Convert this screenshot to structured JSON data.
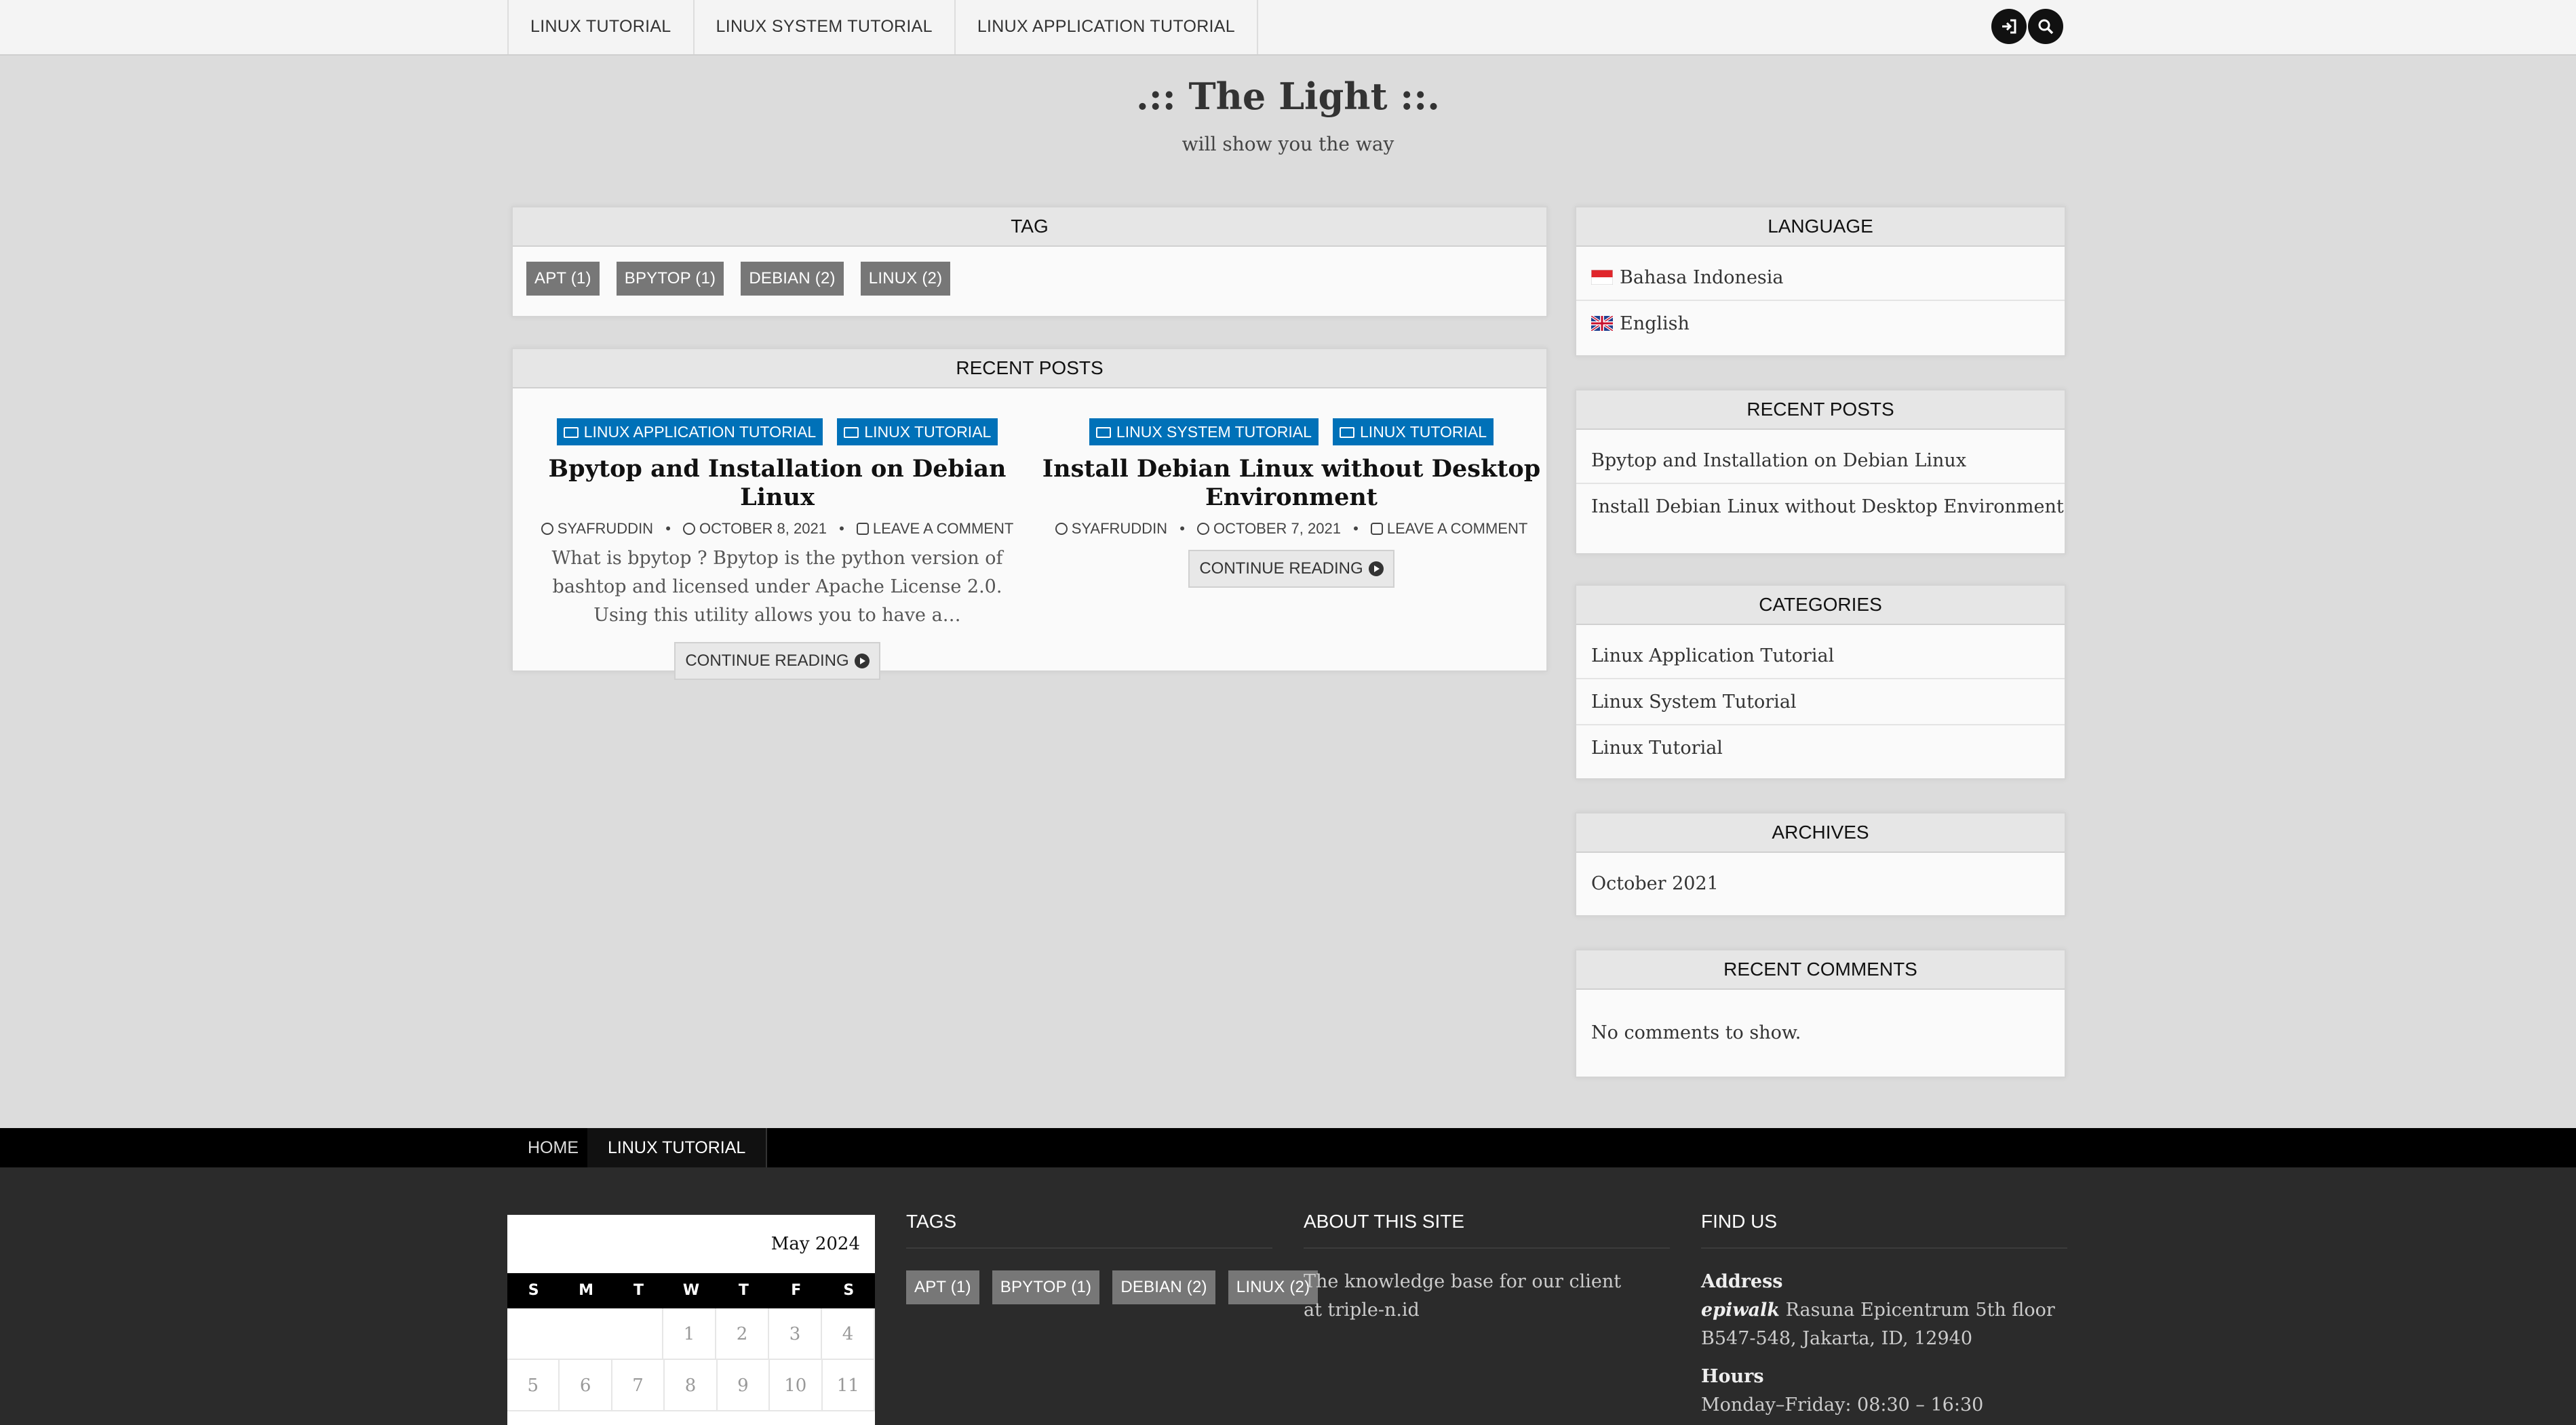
{
  "top_nav": {
    "items": [
      "LINUX TUTORIAL",
      "LINUX SYSTEM TUTORIAL",
      "LINUX APPLICATION TUTORIAL"
    ]
  },
  "header": {
    "title": ".:: The Light ::.",
    "tagline": "will show you the way"
  },
  "tag_widget": {
    "title": "TAG",
    "tags": [
      "APT (1)",
      "BPYTOP (1)",
      "DEBIAN (2)",
      "LINUX (2)"
    ]
  },
  "recent_posts_main": {
    "title": "RECENT POSTS",
    "posts": [
      {
        "categories": [
          "LINUX APPLICATION TUTORIAL",
          "LINUX TUTORIAL"
        ],
        "title": "Bpytop and Installation on Debian Linux",
        "author": "SYAFRUDDIN",
        "date": "OCTOBER 8, 2021",
        "comment": "LEAVE A COMMENT",
        "excerpt": "What is bpytop ? Bpytop is the python version of bashtop and licensed under Apache License 2.0. Using this utility allows you to have a…",
        "more": "CONTINUE READING"
      },
      {
        "categories": [
          "LINUX SYSTEM TUTORIAL",
          "LINUX TUTORIAL"
        ],
        "title": "Install Debian Linux without Desktop Environment",
        "author": "SYAFRUDDIN",
        "date": "OCTOBER 7, 2021",
        "comment": "LEAVE A COMMENT",
        "more": "CONTINUE READING"
      }
    ]
  },
  "sidebar": {
    "language": {
      "title": "LANGUAGE",
      "items": [
        "Bahasa Indonesia",
        "English"
      ]
    },
    "recent_posts": {
      "title": "RECENT POSTS",
      "items": [
        "Bpytop and Installation on Debian Linux",
        "Install Debian Linux without Desktop Environment"
      ]
    },
    "categories": {
      "title": "CATEGORIES",
      "items": [
        "Linux Application Tutorial",
        "Linux System Tutorial",
        "Linux Tutorial"
      ]
    },
    "archives": {
      "title": "ARCHIVES",
      "items": [
        "October 2021"
      ]
    },
    "recent_comments": {
      "title": "RECENT COMMENTS",
      "text": "No comments to show."
    }
  },
  "footer_nav": {
    "items": [
      "HOME",
      "LINUX TUTORIAL"
    ]
  },
  "footer": {
    "calendar": {
      "caption": "May 2024",
      "days": [
        "S",
        "M",
        "T",
        "W",
        "T",
        "F",
        "S"
      ],
      "week1": [
        "1",
        "2",
        "3",
        "4"
      ],
      "week2": [
        "5",
        "6",
        "7",
        "8",
        "9",
        "10",
        "11"
      ]
    },
    "tags": {
      "title": "TAGS",
      "items": [
        "APT (1)",
        "BPYTOP (1)",
        "DEBIAN (2)",
        "LINUX (2)"
      ]
    },
    "about": {
      "title": "ABOUT THIS SITE",
      "line1": "The knowledge base for our client",
      "line2": "at triple-n.id"
    },
    "find_us": {
      "title": "FIND US",
      "address_label": "Address",
      "address_name": "epiwalk",
      "address_line1": " Rasuna Epicentrum 5th floor",
      "address_line2": "B547-548, Jakarta, ID, 12940",
      "hours_label": "Hours",
      "hours_line": "Monday–Friday: 08:30 – 16:30"
    }
  },
  "colors": {
    "category_badge": "#0071b8",
    "tag_badge": "#777777",
    "footer_bg": "#2b2b2b"
  }
}
